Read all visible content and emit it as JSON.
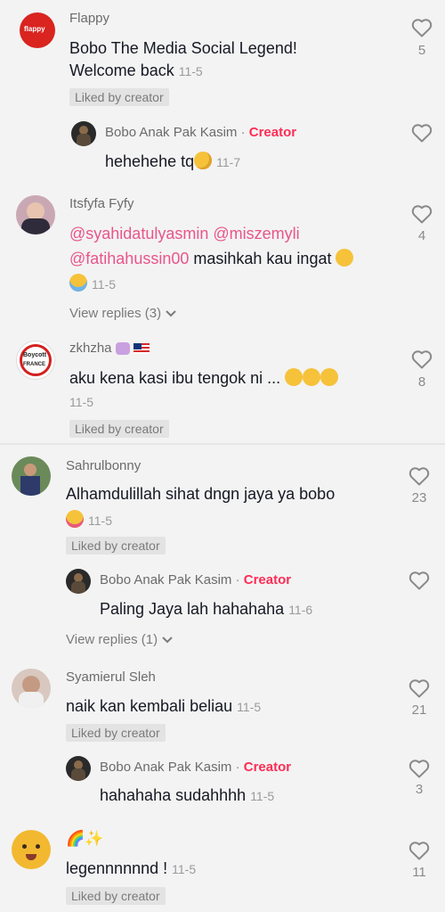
{
  "comments": [
    {
      "name": "Flappy",
      "line1": "Bobo The Media Social Legend!",
      "line2": "Welcome back",
      "date": "11-5",
      "badge": "Liked by creator",
      "likes": "5",
      "avatar_text": "flappy",
      "reply": {
        "name": "Bobo Anak Pak Kasim",
        "sep": "·",
        "creator": "Creator",
        "text": "hehehehe tq",
        "date": "11-7"
      }
    },
    {
      "name": "Itsfyfa Fyfy",
      "mention1": "@syahidatulyasmin",
      "mention2": "@miszemyli",
      "mention3": "@fatihahussin00",
      "text": "masihkah kau ingat",
      "date": "11-5",
      "likes": "4",
      "view_replies": "View replies (3)"
    },
    {
      "name": "zkhzha",
      "text": "aku kena kasi ibu tengok ni ...",
      "date": "11-5",
      "badge": "Liked by creator",
      "likes": "8",
      "avatar_text1": "Boycott",
      "avatar_text2": "FRANCE"
    },
    {
      "name": "Sahrulbonny",
      "text": "Alhamdulillah sihat dngn jaya ya bobo",
      "date": "11-5",
      "badge": "Liked by creator",
      "likes": "23",
      "reply": {
        "name": "Bobo Anak Pak Kasim",
        "sep": "·",
        "creator": "Creator",
        "text": "Paling Jaya lah hahahaha",
        "date": "11-6"
      },
      "view_replies": "View replies (1)"
    },
    {
      "name": "Syamierul Sleh",
      "text": "naik kan kembali beliau",
      "date": "11-5",
      "badge": "Liked by creator",
      "likes": "21",
      "reply": {
        "name": "Bobo Anak Pak Kasim",
        "sep": "·",
        "creator": "Creator",
        "text": "hahahaha sudahhhh",
        "date": "11-5",
        "likes": "3"
      }
    },
    {
      "name": "🌈✨",
      "text": "legennnnnnd !",
      "date": "11-5",
      "badge": "Liked by creator",
      "likes": "11"
    }
  ]
}
